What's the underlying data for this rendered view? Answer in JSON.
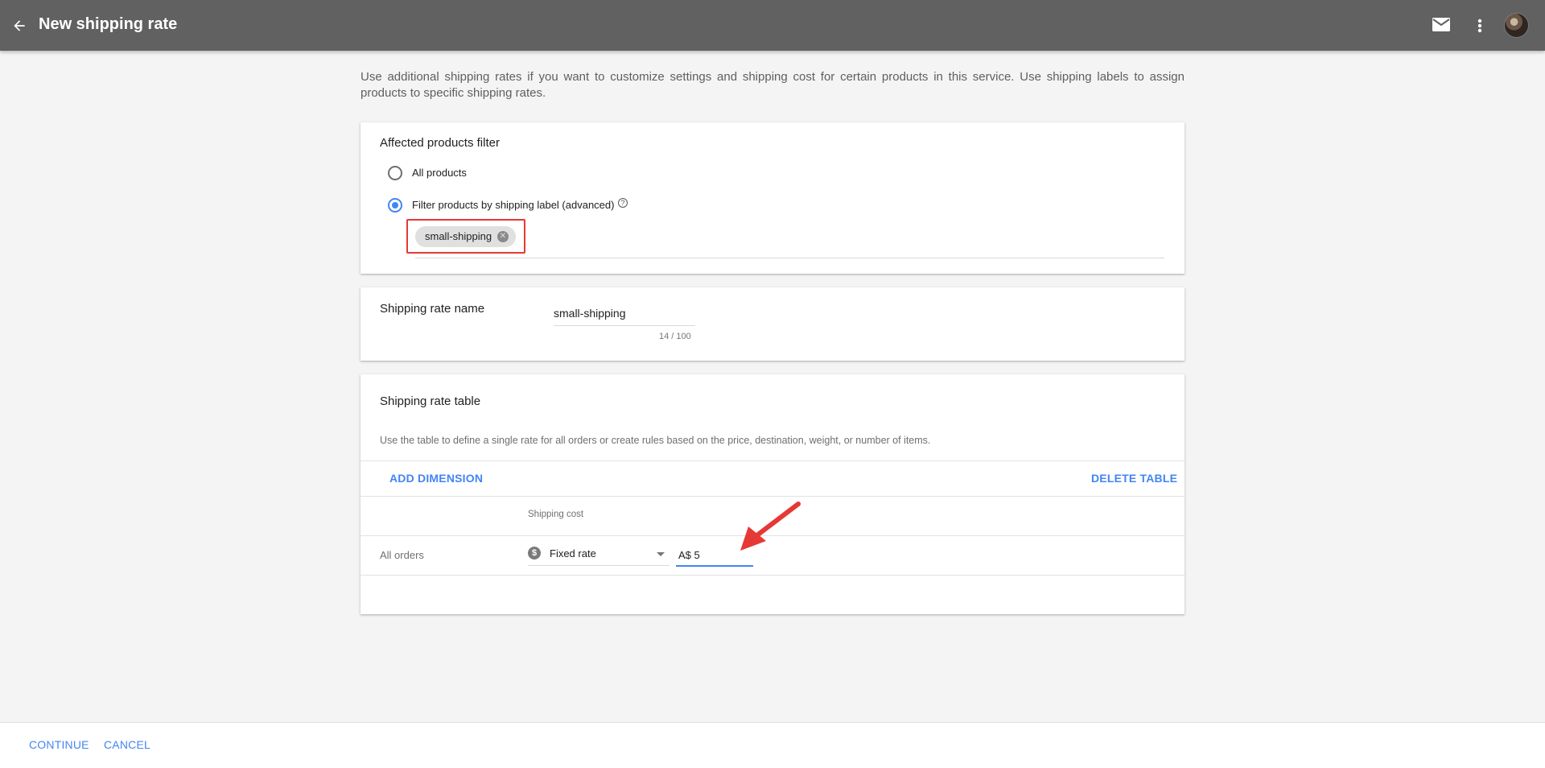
{
  "header": {
    "title": "New shipping rate",
    "back_icon": "arrow-back-icon",
    "mail_icon": "mail-icon",
    "more_icon": "more-vert-icon"
  },
  "intro_text": "Use additional shipping rates if you want to customize settings and shipping cost for certain products in this service. Use shipping labels to assign products to specific shipping rates.",
  "filter_card": {
    "title": "Affected products filter",
    "options": [
      {
        "label": "All products",
        "selected": false
      },
      {
        "label": "Filter products by shipping label (advanced)",
        "selected": true
      }
    ],
    "help_icon": "?",
    "chip": {
      "label": "small-shipping",
      "remove_icon": "✕"
    }
  },
  "name_card": {
    "title": "Shipping rate name",
    "value": "small-shipping",
    "counter": "14 / 100"
  },
  "table_card": {
    "title": "Shipping rate table",
    "description": "Use the table to define a single rate for all orders or create rules based on the price, destination, weight, or number of items.",
    "add_dimension": "ADD DIMENSION",
    "delete_table": "DELETE TABLE",
    "column_header": "Shipping cost",
    "row_label": "All orders",
    "rate_type": "Fixed rate",
    "dollar_symbol": "$",
    "cost_value": "A$ 5"
  },
  "footer": {
    "continue": "CONTINUE",
    "cancel": "CANCEL"
  },
  "colors": {
    "accent": "#4285f4",
    "topbar": "#616161",
    "annotation": "#e53935"
  }
}
